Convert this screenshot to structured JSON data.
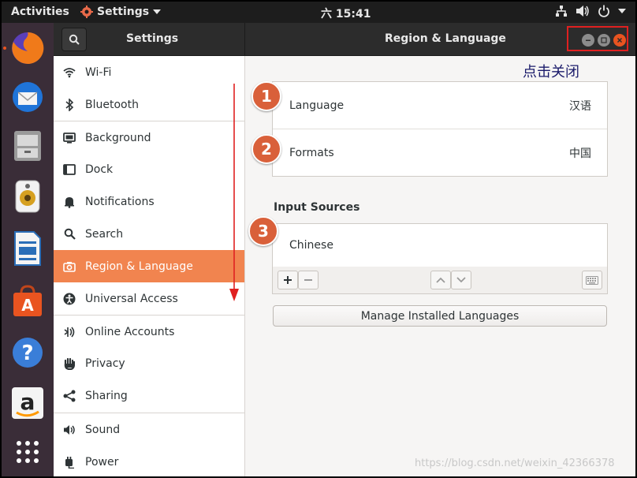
{
  "topbar": {
    "activities": "Activities",
    "app_menu": "Settings",
    "clock": "六 15:41"
  },
  "dock": {
    "items": [
      {
        "name": "firefox-icon",
        "color": "#e66000"
      },
      {
        "name": "thunderbird-icon",
        "color": "#0a84ff"
      },
      {
        "name": "files-icon",
        "color": "#8c8c8c"
      },
      {
        "name": "rhythmbox-icon",
        "color": "#f0c040"
      },
      {
        "name": "libreoffice-writer-icon",
        "color": "#2a6eb8"
      },
      {
        "name": "ubuntu-software-icon",
        "color": "#e95420"
      },
      {
        "name": "help-icon",
        "color": "#3a7ed8"
      },
      {
        "name": "amazon-icon",
        "color": "#ff9900"
      },
      {
        "name": "show-applications-icon",
        "color": "#ffffff"
      }
    ]
  },
  "header": {
    "left_title": "Settings",
    "right_title": "Region & Language"
  },
  "sidebar": {
    "items": [
      {
        "label": "Wi-Fi",
        "icon": "wifi-icon"
      },
      {
        "label": "Bluetooth",
        "icon": "bluetooth-icon"
      },
      {
        "label": "Background",
        "icon": "background-icon"
      },
      {
        "label": "Dock",
        "icon": "dock-icon"
      },
      {
        "label": "Notifications",
        "icon": "bell-icon"
      },
      {
        "label": "Search",
        "icon": "search-icon"
      },
      {
        "label": "Region & Language",
        "icon": "camera-icon"
      },
      {
        "label": "Universal Access",
        "icon": "accessibility-icon"
      },
      {
        "label": "Online Accounts",
        "icon": "online-accounts-icon"
      },
      {
        "label": "Privacy",
        "icon": "hand-icon"
      },
      {
        "label": "Sharing",
        "icon": "share-icon"
      },
      {
        "label": "Sound",
        "icon": "speaker-icon"
      },
      {
        "label": "Power",
        "icon": "power-plug-icon"
      }
    ]
  },
  "main": {
    "annotation": "点击关闭",
    "language_label": "Language",
    "language_value": "汉语",
    "formats_label": "Formats",
    "formats_value": "中国",
    "input_sources_title": "Input Sources",
    "input_source": "Chinese",
    "manage_button": "Manage Installed Languages",
    "badges": [
      "1",
      "2",
      "3"
    ]
  },
  "watermark": "https://blog.csdn.net/weixin_42366378",
  "colors": {
    "accent": "#f1844f",
    "badge": "#d9603a",
    "annotation_red": "#e02020"
  }
}
